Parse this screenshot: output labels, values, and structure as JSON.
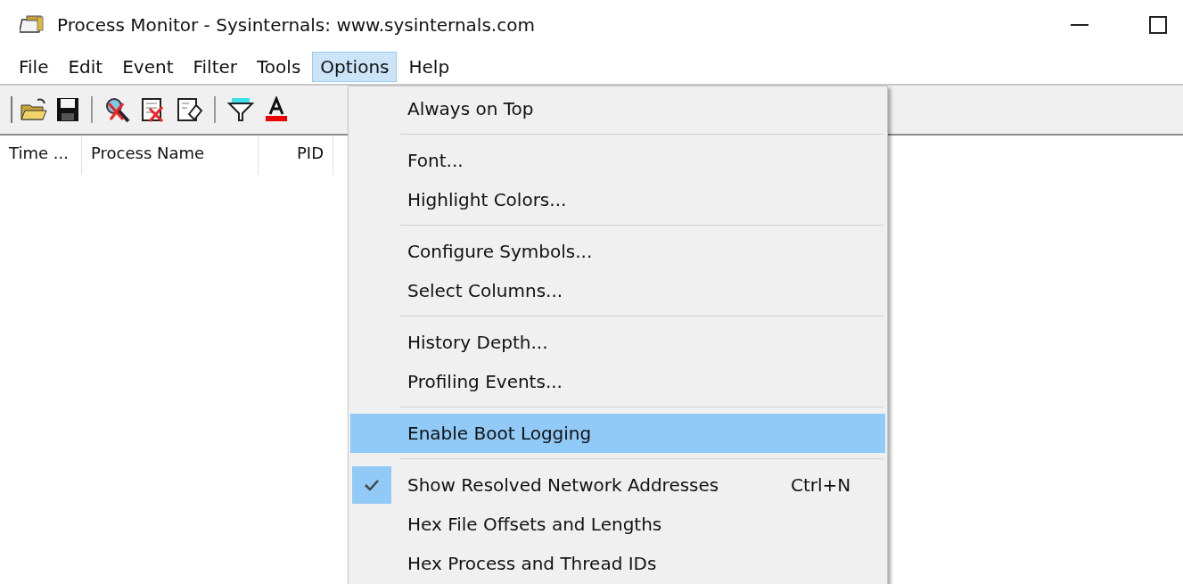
{
  "window": {
    "title": "Process Monitor - Sysinternals: www.sysinternals.com"
  },
  "menu_bar": [
    {
      "label": "File",
      "selected": false
    },
    {
      "label": "Edit",
      "selected": false
    },
    {
      "label": "Event",
      "selected": false
    },
    {
      "label": "Filter",
      "selected": false
    },
    {
      "label": "Tools",
      "selected": false
    },
    {
      "label": "Options",
      "selected": true
    },
    {
      "label": "Help",
      "selected": false
    }
  ],
  "columns": [
    "Time ...",
    "Process Name",
    "PID"
  ],
  "options_menu": [
    {
      "kind": "item",
      "label": "Always on Top",
      "checked": false,
      "selected": false
    },
    {
      "kind": "separator"
    },
    {
      "kind": "item",
      "label": "Font...",
      "checked": false,
      "selected": false
    },
    {
      "kind": "item",
      "label": "Highlight Colors...",
      "checked": false,
      "selected": false
    },
    {
      "kind": "separator"
    },
    {
      "kind": "item",
      "label": "Configure Symbols...",
      "checked": false,
      "selected": false
    },
    {
      "kind": "item",
      "label": "Select Columns...",
      "checked": false,
      "selected": false
    },
    {
      "kind": "separator"
    },
    {
      "kind": "item",
      "label": "History Depth...",
      "checked": false,
      "selected": false
    },
    {
      "kind": "item",
      "label": "Profiling Events...",
      "checked": false,
      "selected": false
    },
    {
      "kind": "separator"
    },
    {
      "kind": "item",
      "label": "Enable Boot Logging",
      "checked": false,
      "selected": true
    },
    {
      "kind": "separator"
    },
    {
      "kind": "item",
      "label": "Show Resolved Network Addresses",
      "shortcut": "Ctrl+N",
      "checked": true,
      "selected": false
    },
    {
      "kind": "item",
      "label": "Hex File Offsets and Lengths",
      "checked": false,
      "selected": false
    },
    {
      "kind": "item",
      "label": "Hex Process and Thread IDs",
      "checked": false,
      "selected": false
    }
  ]
}
